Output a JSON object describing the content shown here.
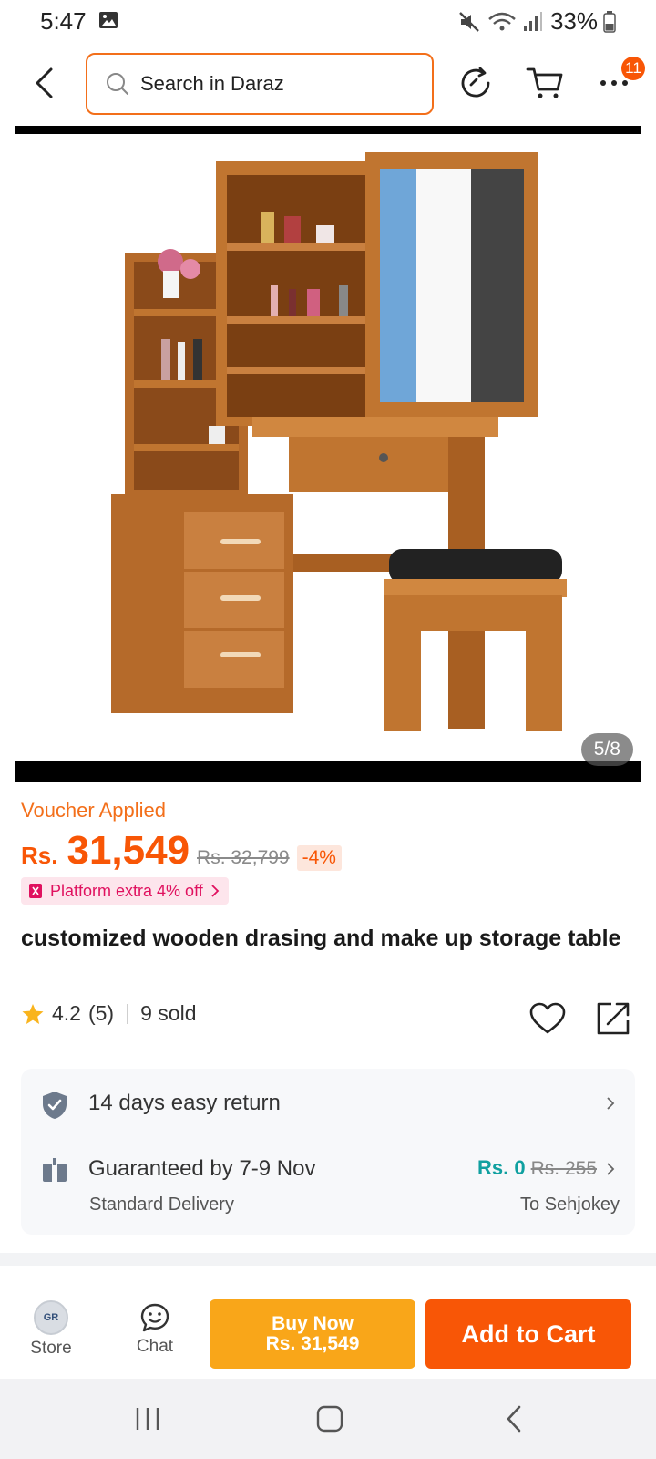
{
  "status_bar": {
    "time": "5:47",
    "battery": "33%"
  },
  "header": {
    "search_placeholder": "Search in Daraz",
    "notification_count": "11"
  },
  "gallery": {
    "page_indicator": "5/8"
  },
  "pricing": {
    "voucher_label": "Voucher Applied",
    "currency": "Rs.",
    "price": "31,549",
    "original_price": "Rs. 32,799",
    "discount": "-4%",
    "platform_offer": "Platform extra 4% off"
  },
  "product": {
    "title": "customized wooden drasing and make up storage table",
    "rating": "4.2",
    "review_count": "(5)",
    "sold": "9 sold"
  },
  "services": {
    "return_policy": "14 days easy return",
    "delivery_guarantee": "Guaranteed by 7-9 Nov",
    "delivery_type": "Standard Delivery",
    "shipping_fee": "Rs. 0",
    "shipping_fee_original": "Rs. 255",
    "destination": "To Sehjokey"
  },
  "action_bar": {
    "store_label": "Store",
    "chat_label": "Chat",
    "buy_now_label": "Buy Now",
    "buy_now_price": "Rs. 31,549",
    "add_to_cart_label": "Add to Cart"
  },
  "colors": {
    "brand_orange": "#f85606",
    "buy_now_yellow": "#f9a619",
    "free_shipping_teal": "#10a0a0",
    "platform_pink": "#e0115f"
  }
}
